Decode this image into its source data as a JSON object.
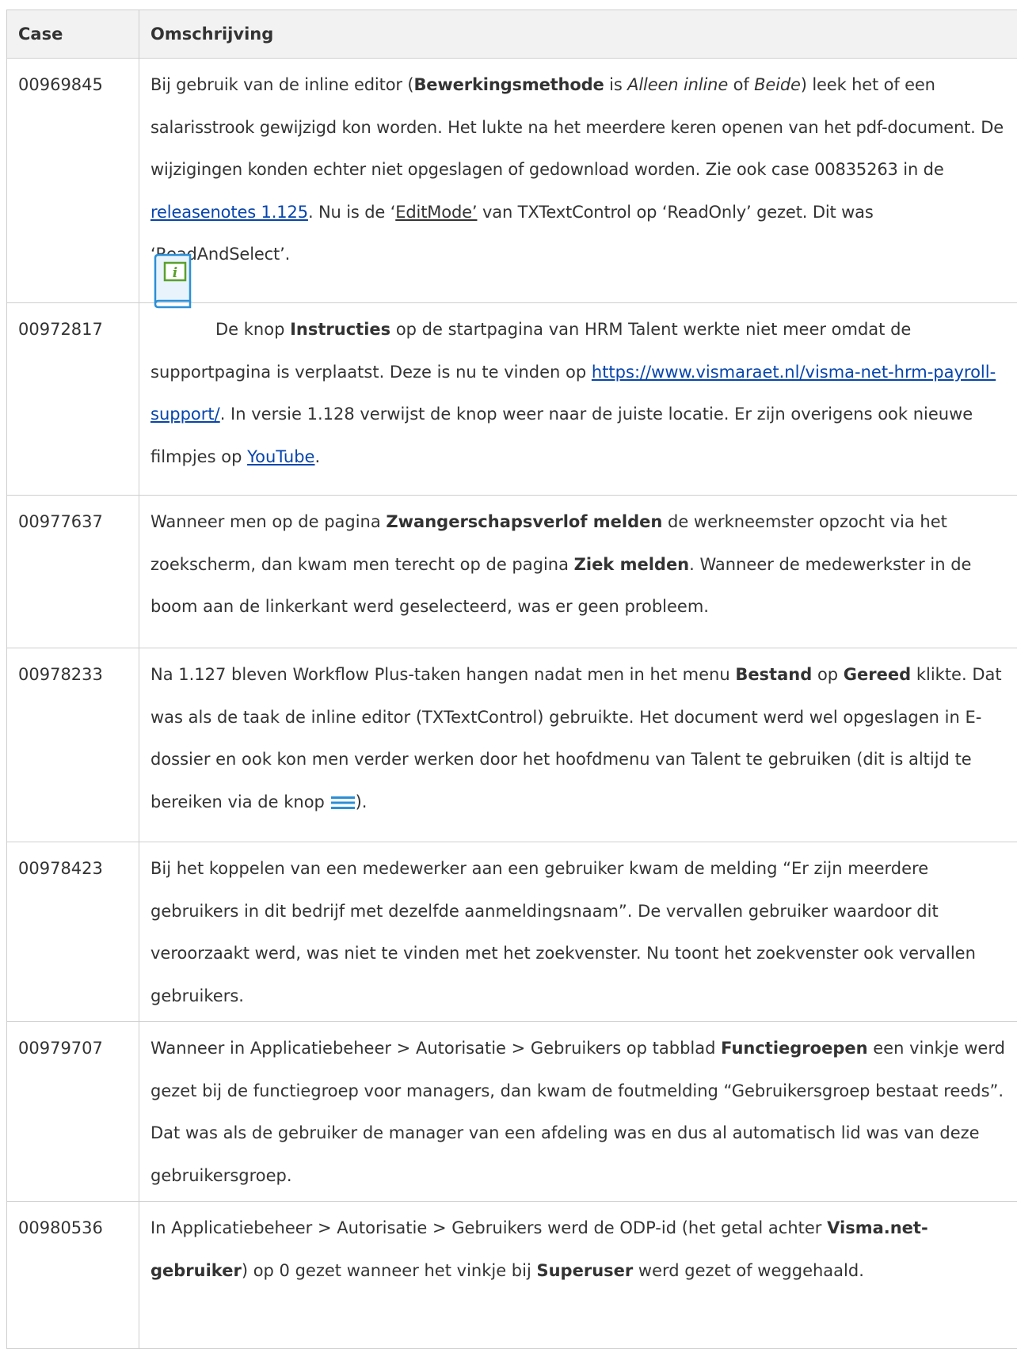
{
  "header": {
    "case": "Case",
    "description": "Omschrijving"
  },
  "rows": [
    {
      "id": "00969845",
      "parts": {
        "a": "Bij gebruik van de inline editor (",
        "b": "Bewerkingsmethode",
        "c": " is ",
        "d": "Alleen inline",
        "e": " of ",
        "f": "Beide",
        "g": ") leek het of een salarisstrook gewijzigd kon worden. Het lukte na het meerdere keren openen van het pdf-document. De wijzigingen konden echter niet opgeslagen of gedownload worden. Zie ook case 00835263 in de ",
        "link": "releasenotes 1.125",
        "h": ". Nu is de ‘",
        "i": "EditMode’",
        "j": " van TXTextControl op ‘ReadOnly’ gezet. Dit was ‘ReadAndSelect’."
      }
    },
    {
      "id": "00972817",
      "icon": "info-book-icon",
      "parts": {
        "a": "De knop ",
        "b": "Instructies",
        "c": " op de startpagina van HRM Talent werkte niet meer omdat de supportpagina is verplaatst. Deze is nu te vinden op ",
        "link1": "https://www.vismaraet.nl/visma-net-hrm-payroll-support/",
        "d": ". In versie 1.128 verwijst de knop weer naar de juiste locatie. Er zijn overigens ook nieuwe filmpjes op ",
        "link2": "YouTube",
        "e": "."
      }
    },
    {
      "id": "00977637",
      "parts": {
        "a": "Wanneer men op de pagina ",
        "b": "Zwangerschapsverlof melden",
        "c": " de werkneemster opzocht via het zoekscherm, dan kwam men terecht op de pagina ",
        "d": "Ziek melden",
        "e": ". Wanneer de medewerkster in de boom aan de linkerkant werd geselecteerd, was er geen probleem."
      }
    },
    {
      "id": "00978233",
      "parts": {
        "a": "Na 1.127 bleven Workflow Plus-taken hangen nadat men in het menu ",
        "b": "Bestand",
        "c": " op ",
        "d": "Gereed",
        "e": " klikte. Dat was als de taak de inline editor (TXTextControl) gebruikte. Het document werd wel opgeslagen in E-dossier en ook kon men verder werken door het hoofdmenu van Talent te gebruiken (dit is altijd te bereiken via de knop ",
        "icon": "hamburger-menu-icon",
        "f": ")."
      }
    },
    {
      "id": "00978423",
      "parts": {
        "a": "Bij het koppelen van een medewerker aan een gebruiker kwam de melding “Er zijn meerdere gebruikers in dit bedrijf met dezelfde aanmeldingsnaam”. De vervallen gebruiker waardoor dit veroorzaakt werd, was niet te vinden met het zoekvenster. Nu toont het zoekvenster ook vervallen gebruikers."
      }
    },
    {
      "id": "00979707",
      "parts": {
        "a": "Wanneer in Applicatiebeheer > Autorisatie > Gebruikers op tabblad ",
        "b": "Functiegroepen",
        "c": " een vinkje werd gezet bij de functiegroep voor managers, dan kwam de foutmelding “Gebruikersgroep bestaat reeds”. Dat was als de gebruiker de manager van een afdeling was en dus al automatisch lid was van deze gebruikersgroep."
      }
    },
    {
      "id": "00980536",
      "parts": {
        "a": "In Applicatiebeheer > Autorisatie > Gebruikers werd de ODP-id (het getal achter ",
        "b": "Visma.net-gebruiker",
        "c": ") op 0 gezet wanneer het vinkje bij ",
        "d": "Superuser",
        "e": " werd gezet of weggehaald."
      }
    }
  ],
  "colors": {
    "link": "#0645ad",
    "header_bg": "#f2f2f2",
    "border": "#cfcfcf",
    "icon_blue": "#2b8fd6",
    "icon_green": "#5aa02c"
  }
}
